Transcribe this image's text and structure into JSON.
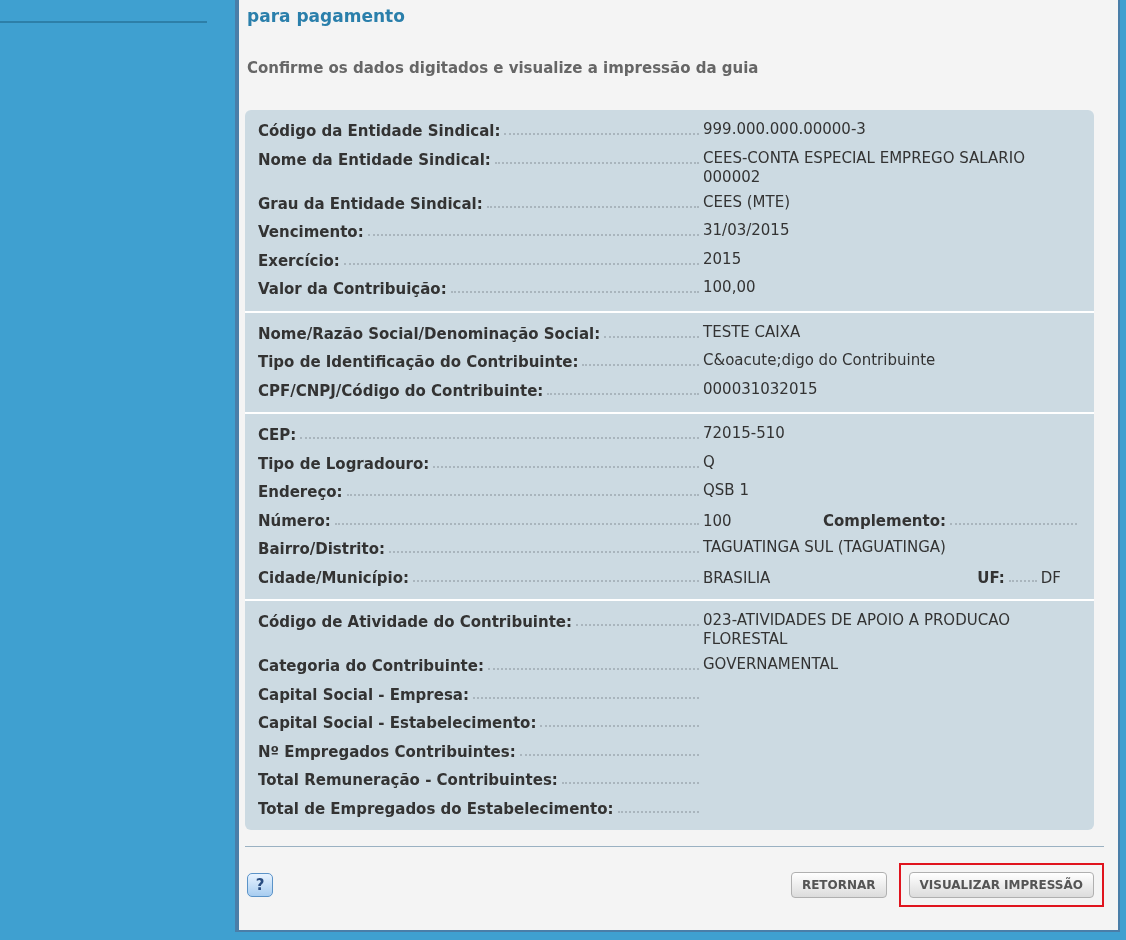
{
  "heading": "para pagamento",
  "instruction": "Confirme os dados digitados e visualize a impressão da guia",
  "sections": [
    {
      "rows": [
        {
          "label": "Código da Entidade Sindical:",
          "value": "999.000.000.00000-3"
        },
        {
          "label": "Nome da Entidade Sindical:",
          "value": "CEES-CONTA ESPECIAL EMPREGO SALARIO 000002"
        },
        {
          "label": "Grau da Entidade Sindical:",
          "value": "CEES (MTE)"
        },
        {
          "label": "Vencimento:",
          "value": "31/03/2015"
        },
        {
          "label": "Exercício:",
          "value": "2015"
        },
        {
          "label": "Valor da Contribuição:",
          "value": "100,00"
        }
      ]
    },
    {
      "rows": [
        {
          "label": "Nome/Razão Social/Denominação Social:",
          "value": "TESTE CAIXA"
        },
        {
          "label": "Tipo de Identificação do Contribuinte:",
          "value": "C&oacute;digo do Contribuinte"
        },
        {
          "label": "CPF/CNPJ/Código do Contribuinte:",
          "value": "000031032015"
        }
      ]
    },
    {
      "rows": [
        {
          "label": "CEP:",
          "value": "72015-510"
        },
        {
          "label": "Tipo de Logradouro:",
          "value": "Q"
        },
        {
          "label": "Endereço:",
          "value": "QSB 1"
        },
        {
          "label": "Número:",
          "value": "100",
          "extra": {
            "label": "Complemento:"
          }
        },
        {
          "label": "Bairro/Distrito:",
          "value": "TAGUATINGA SUL (TAGUATINGA)"
        },
        {
          "label": "Cidade/Município:",
          "value": "BRASILIA",
          "extra": {
            "label": "UF:",
            "value": "DF"
          }
        }
      ]
    },
    {
      "rows": [
        {
          "label": "Código de Atividade do Contribuinte:",
          "value": "023-ATIVIDADES DE APOIO A PRODUCAO FLORESTAL"
        },
        {
          "label": "Categoria do Contribuinte:",
          "value": "GOVERNAMENTAL"
        },
        {
          "label": "Capital Social - Empresa:"
        },
        {
          "label": "Capital Social - Estabelecimento:"
        },
        {
          "label": "Nº Empregados Contribuintes:"
        },
        {
          "label": "Total Remuneração - Contribuintes:"
        },
        {
          "label": "Total de Empregados do Estabelecimento:"
        }
      ]
    }
  ],
  "help": "?",
  "buttons": [
    {
      "label": "RETORNAR",
      "highlighted": false
    },
    {
      "label": "VISUALIZAR IMPRESSÃO",
      "highlighted": true
    }
  ]
}
